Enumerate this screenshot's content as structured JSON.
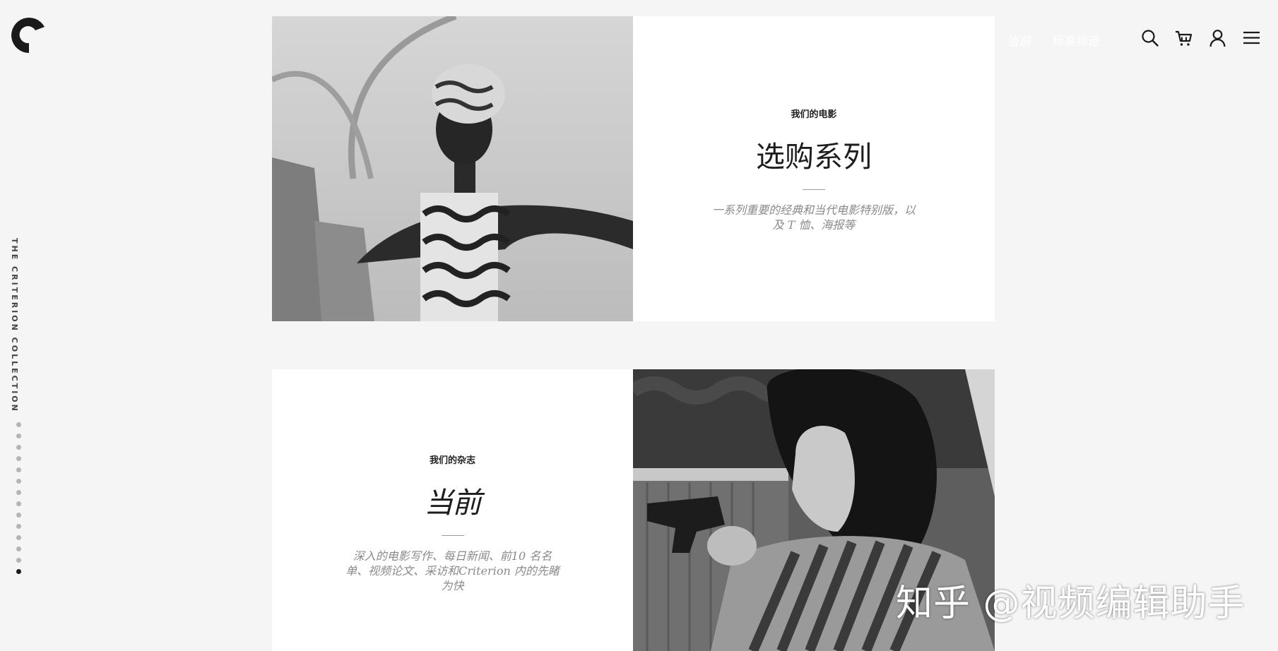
{
  "brand": {
    "side_text": "THE CRITERION COLLECTION"
  },
  "header": {
    "links": [
      {
        "label": "当前"
      },
      {
        "label": "标准频道"
      }
    ],
    "icons": [
      "search-icon",
      "cart-icon",
      "account-icon",
      "menu-icon"
    ]
  },
  "section_films": {
    "eyebrow": "我们的电影",
    "title": "选购系列",
    "description_line1": "一系列重要的经典和当代电影特别版，以",
    "description_line2": "及 T 恤、海报等"
  },
  "section_magazine": {
    "eyebrow": "我们的杂志",
    "title": "当前",
    "description_line1": "深入的电影写作、每日新闻、前10 名名",
    "description_line2": "单、视频论文、采访和Criterion 内的先睹",
    "description_line3": "为快"
  },
  "dot_nav": {
    "count": 14,
    "active_index": 13
  },
  "watermark": "知乎 @视频编辑助手",
  "colors": {
    "background": "#f5f5f5",
    "card": "#ffffff",
    "text": "#1d1d1d",
    "muted": "#8a8a8a",
    "dot_inactive": "#b5b5b5",
    "dot_active": "#1a1a1a"
  }
}
